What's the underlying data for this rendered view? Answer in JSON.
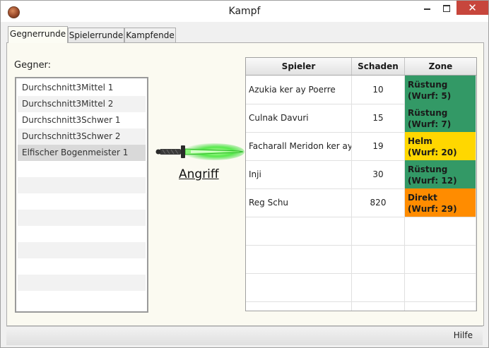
{
  "window": {
    "title": "Kampf",
    "icon": "app-emblem-icon"
  },
  "tabs": [
    {
      "label": "Gegnerrunde",
      "active": true
    },
    {
      "label": "Spielerrunde",
      "active": false
    },
    {
      "label": "Kampfende",
      "active": false
    }
  ],
  "enemies": {
    "label": "Gegner:",
    "items": [
      {
        "name": "Durchschnitt3Mittel 1"
      },
      {
        "name": "Durchschnitt3Mittel 2"
      },
      {
        "name": "Durchschnitt3Schwer 1"
      },
      {
        "name": "Durchschnitt3Schwer 2"
      },
      {
        "name": "Elfischer Bogenmeister 1",
        "selected": true
      }
    ]
  },
  "attack": {
    "label": "Angriff",
    "icon": "glowing-dagger-icon"
  },
  "players_table": {
    "columns": [
      "Spieler",
      "Schaden",
      "Zone"
    ],
    "rows": [
      {
        "player": "Azukia ker ay Poerre",
        "damage": "10",
        "zone": "Rüstung",
        "roll": "(Wurf: 5)",
        "zone_color": "#339966"
      },
      {
        "player": "Culnak Davuri",
        "damage": "15",
        "zone": "Rüstung",
        "roll": "(Wurf: 7)",
        "zone_color": "#339966"
      },
      {
        "player": "Facharall Meridon ker ay ...",
        "damage": "19",
        "zone": "Helm",
        "roll": "(Wurf: 20)",
        "zone_color": "#ffd700"
      },
      {
        "player": "Inji",
        "damage": "30",
        "zone": "Rüstung",
        "roll": "(Wurf: 12)",
        "zone_color": "#339966"
      },
      {
        "player": "Reg Schu",
        "damage": "820",
        "zone": "Direkt",
        "roll": "(Wurf: 29)",
        "zone_color": "#ff8c00"
      }
    ]
  },
  "status_bar": {
    "help_label": "Hilfe"
  }
}
